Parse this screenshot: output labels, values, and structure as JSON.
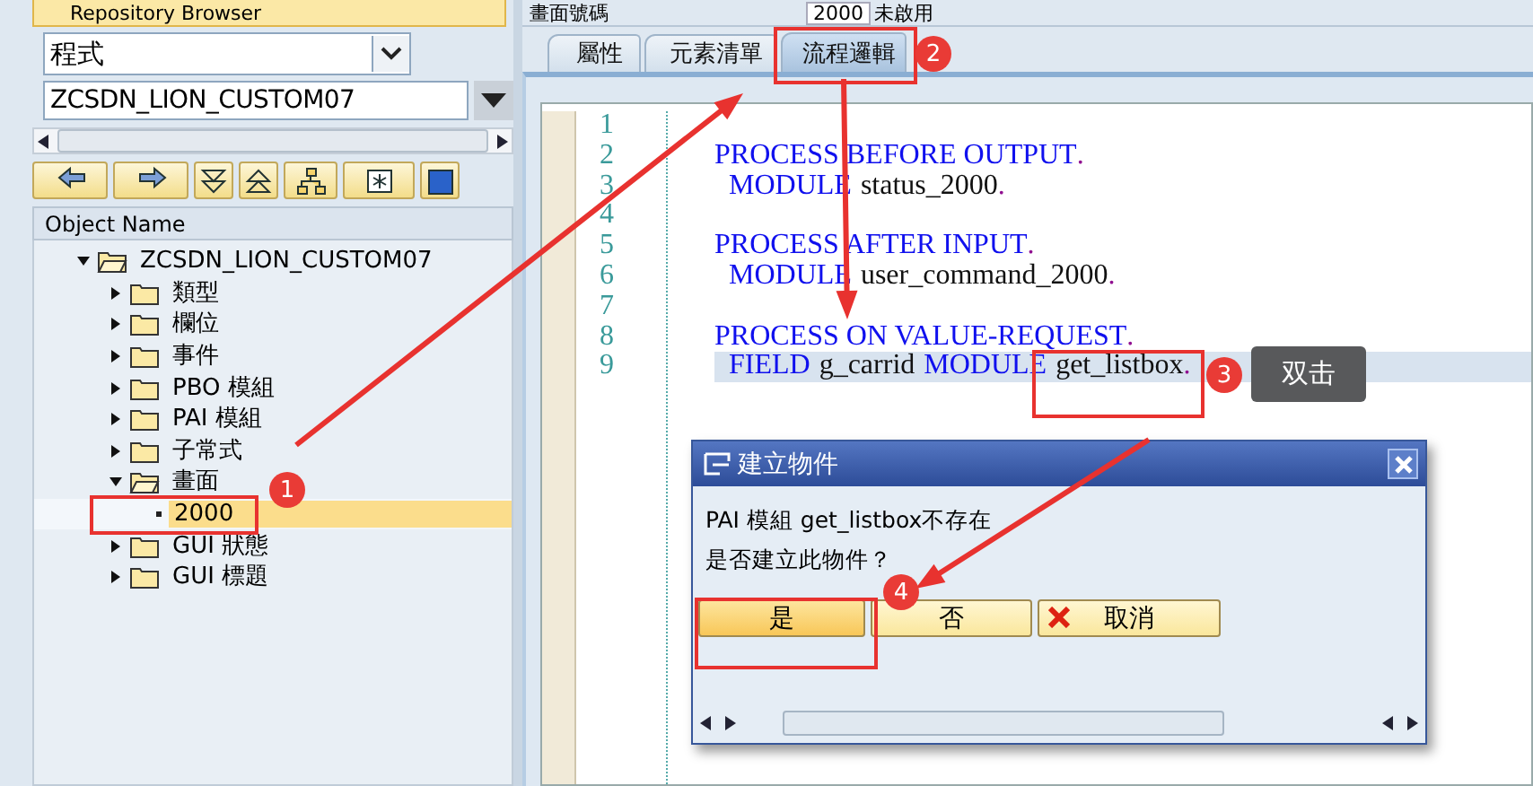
{
  "browser": {
    "title": "Repository Browser",
    "object_type": "程式",
    "object_name": "ZCSDN_LION_CUSTOM07"
  },
  "tree": {
    "column": "Object Name",
    "items": [
      {
        "label": "ZCSDN_LION_CUSTOM07",
        "kind": "folder",
        "expanded": true,
        "selected": false,
        "children": [
          {
            "label": "類型",
            "kind": "folder",
            "expanded": false,
            "selected": false
          },
          {
            "label": "欄位",
            "kind": "folder",
            "expanded": false,
            "selected": false
          },
          {
            "label": "事件",
            "kind": "folder",
            "expanded": false,
            "selected": false
          },
          {
            "label": "PBO 模組",
            "kind": "folder",
            "expanded": false,
            "selected": false
          },
          {
            "label": "PAI 模組",
            "kind": "folder",
            "expanded": false,
            "selected": false
          },
          {
            "label": "子常式",
            "kind": "folder",
            "expanded": false,
            "selected": false
          },
          {
            "label": "畫面",
            "kind": "folder",
            "expanded": true,
            "selected": false,
            "children": [
              {
                "label": "2000",
                "kind": "leaf",
                "selected": true
              }
            ]
          },
          {
            "label": "GUI 狀態",
            "kind": "folder",
            "expanded": false,
            "selected": false
          },
          {
            "label": "GUI 標題",
            "kind": "folder",
            "expanded": false,
            "selected": false
          }
        ]
      }
    ]
  },
  "screen": {
    "label": "畫面號碼",
    "number": "2000",
    "status": "未啟用"
  },
  "tabs": [
    {
      "label": "屬性",
      "selected": false
    },
    {
      "label": "元素清單",
      "selected": false
    },
    {
      "label": "流程邏輯",
      "selected": true
    }
  ],
  "code": [
    {
      "number": "1",
      "kind": "blank"
    },
    {
      "number": "2",
      "kind": "event",
      "tokens": [
        {
          "kind": "keyword",
          "text": "PROCESS BEFORE OUTPUT"
        },
        {
          "kind": "punct",
          "text": "."
        }
      ]
    },
    {
      "number": "3",
      "kind": "statement",
      "tokens": [
        {
          "kind": "keyword",
          "text": "MODULE"
        },
        {
          "kind": "ident",
          "text": "status_2000"
        },
        {
          "kind": "punct",
          "text": "."
        }
      ]
    },
    {
      "number": "4",
      "kind": "blank"
    },
    {
      "number": "5",
      "kind": "event",
      "tokens": [
        {
          "kind": "keyword",
          "text": "PROCESS AFTER INPUT"
        },
        {
          "kind": "punct",
          "text": "."
        }
      ]
    },
    {
      "number": "6",
      "kind": "statement",
      "tokens": [
        {
          "kind": "keyword",
          "text": "MODULE"
        },
        {
          "kind": "ident",
          "text": "user_command_2000"
        },
        {
          "kind": "punct",
          "text": "."
        }
      ]
    },
    {
      "number": "7",
      "kind": "blank"
    },
    {
      "number": "8",
      "kind": "event",
      "tokens": [
        {
          "kind": "keyword",
          "text": "PROCESS ON VALUE-REQUEST"
        },
        {
          "kind": "punct",
          "text": "."
        }
      ]
    },
    {
      "number": "9",
      "kind": "statement",
      "current": true,
      "tokens": [
        {
          "kind": "keyword",
          "text": "FIELD"
        },
        {
          "kind": "ident",
          "text": "g_carrid"
        },
        {
          "kind": "keyword",
          "text": "MODULE"
        },
        {
          "kind": "ident",
          "text": "get_listbox"
        },
        {
          "kind": "punct",
          "text": "."
        }
      ]
    }
  ],
  "dialog": {
    "title": "建立物件",
    "message": [
      "PAI 模組 get_listbox不存在",
      "是否建立此物件？"
    ],
    "buttons": [
      {
        "label": "是",
        "kind": "plain",
        "selected": true
      },
      {
        "label": "否",
        "kind": "plain",
        "selected": false
      },
      {
        "label": "取消",
        "kind": "cancel",
        "selected": false
      }
    ]
  },
  "annotations": {
    "steps": [
      "1",
      "2",
      "3",
      "4"
    ],
    "note": "双击"
  }
}
